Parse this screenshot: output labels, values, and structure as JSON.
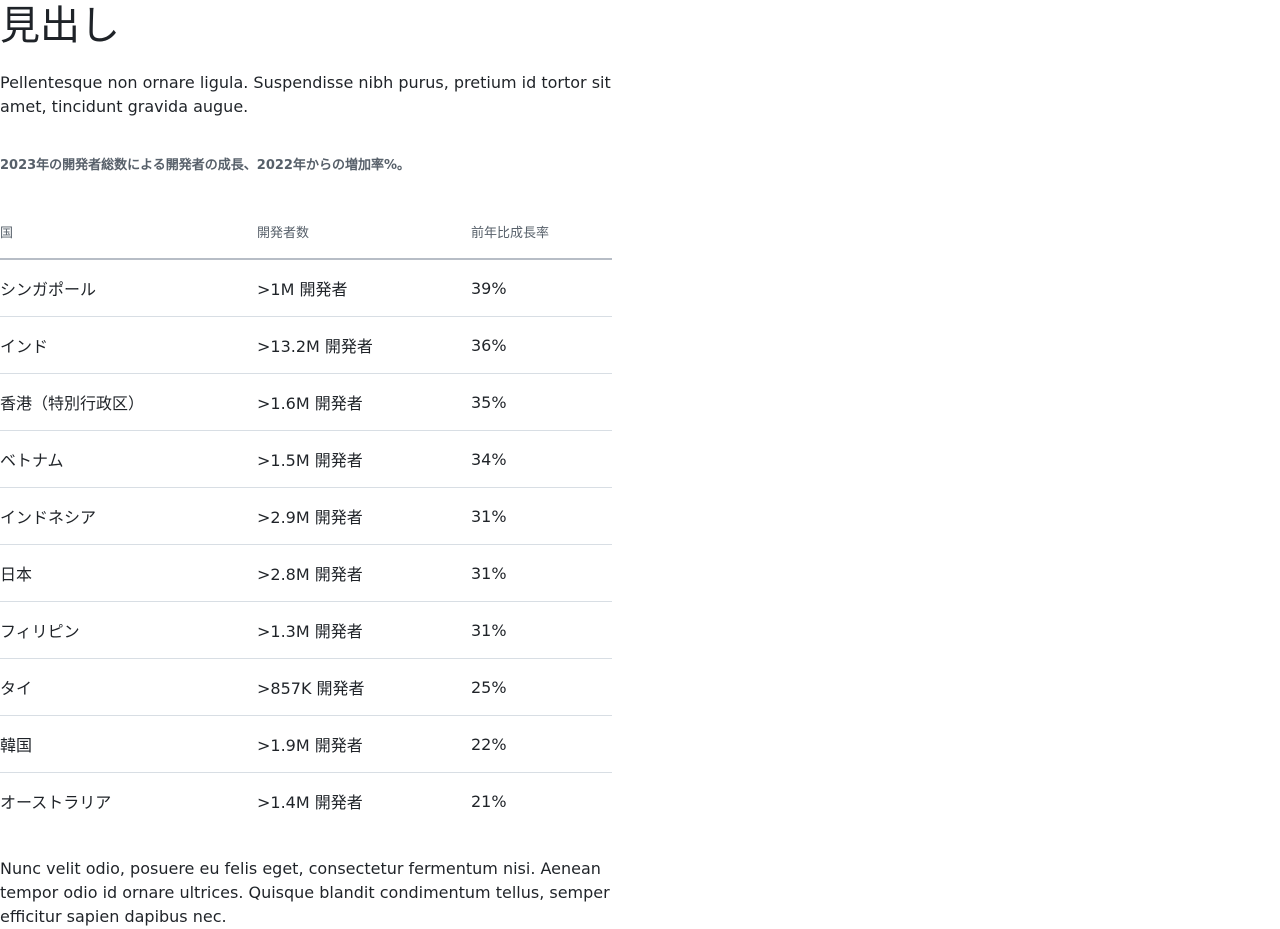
{
  "heading": "見出し",
  "intro": "Pellentesque non ornare ligula. Suspendisse nibh purus, pretium id tortor sit amet, tincidunt gravida augue.",
  "table": {
    "caption": "2023年の開発者総数による開発者の成長、2022年からの増加率%。",
    "headers": [
      "国",
      "開発者数",
      "前年比成長率"
    ],
    "rows": [
      [
        "シンガポール",
        ">1M 開発者",
        "39%"
      ],
      [
        "インド",
        ">13.2M 開発者",
        "36%"
      ],
      [
        "香港（特別行政区）",
        ">1.6M 開発者",
        "35%"
      ],
      [
        "ベトナム",
        ">1.5M 開発者",
        "34%"
      ],
      [
        "インドネシア",
        ">2.9M 開発者",
        "31%"
      ],
      [
        "日本",
        ">2.8M 開発者",
        "31%"
      ],
      [
        "フィリピン",
        ">1.3M 開発者",
        "31%"
      ],
      [
        "タイ",
        ">857K 開発者",
        "25%"
      ],
      [
        "韓国",
        ">1.9M 開発者",
        "22%"
      ],
      [
        "オーストラリア",
        ">1.4M 開発者",
        "21%"
      ]
    ]
  },
  "outro": "Nunc velit odio, posuere eu felis eget, consectetur fermentum nisi. Aenean tempor odio id ornare ultrices. Quisque blandit condimentum tellus, semper efficitur sapien dapibus nec."
}
